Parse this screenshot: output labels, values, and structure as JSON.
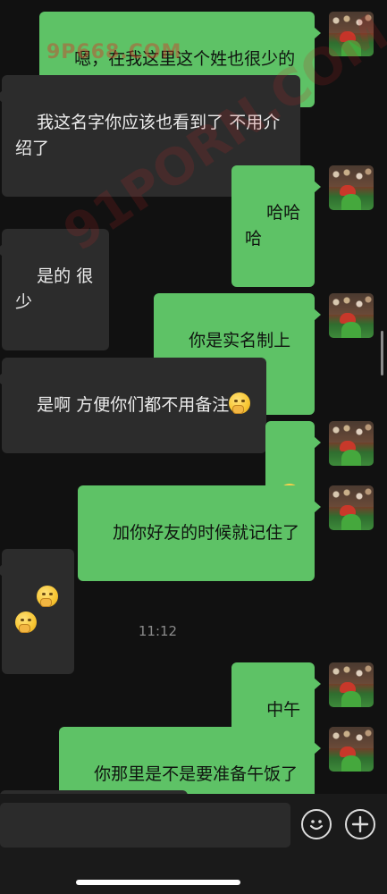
{
  "messages": [
    {
      "dir": "out",
      "text": "嗯，在我这里这个姓也很少的"
    },
    {
      "dir": "in",
      "text": "我这名字你应该也看到了 不用介\n绍了"
    },
    {
      "dir": "out",
      "text": "哈哈哈"
    },
    {
      "dir": "in",
      "text": "是的 很少"
    },
    {
      "dir": "out",
      "text": "你是实名制上网"
    },
    {
      "dir": "in",
      "text": "是啊 方便你们都不用备注"
    },
    {
      "dir": "out",
      "text": ""
    },
    {
      "dir": "out",
      "text": "加你好友的时候就记住了"
    },
    {
      "dir": "in",
      "text": ""
    },
    {
      "dir": "out",
      "text": "中午了"
    },
    {
      "dir": "out",
      "text": "你那里是不是要准备午饭了"
    }
  ],
  "timestamp": "11:12",
  "watermarks": {
    "top": "9P668.COM",
    "diagonal": "91PORN.COM"
  },
  "icons": {
    "emoji": "thinking-face-emoji",
    "smiley_button": "smiley-face-icon",
    "plus_button": "plus-circle-icon"
  }
}
